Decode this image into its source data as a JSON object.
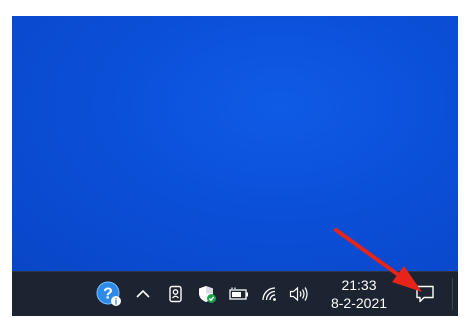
{
  "desktop": {
    "background_color": "#0b4fd8"
  },
  "taskbar": {
    "background_color": "#1b2430",
    "tray_icons": [
      {
        "icon": "help-icon"
      },
      {
        "icon": "chevron-up-icon"
      },
      {
        "icon": "meet-now-icon"
      },
      {
        "icon": "windows-security-icon"
      },
      {
        "icon": "battery-icon"
      },
      {
        "icon": "wifi-icon"
      },
      {
        "icon": "volume-icon"
      }
    ],
    "clock": {
      "time": "21:33",
      "date": "8-2-2021"
    },
    "action_center": {
      "icon": "notification-icon"
    }
  },
  "annotation": {
    "arrow_color": "#e8241a"
  }
}
